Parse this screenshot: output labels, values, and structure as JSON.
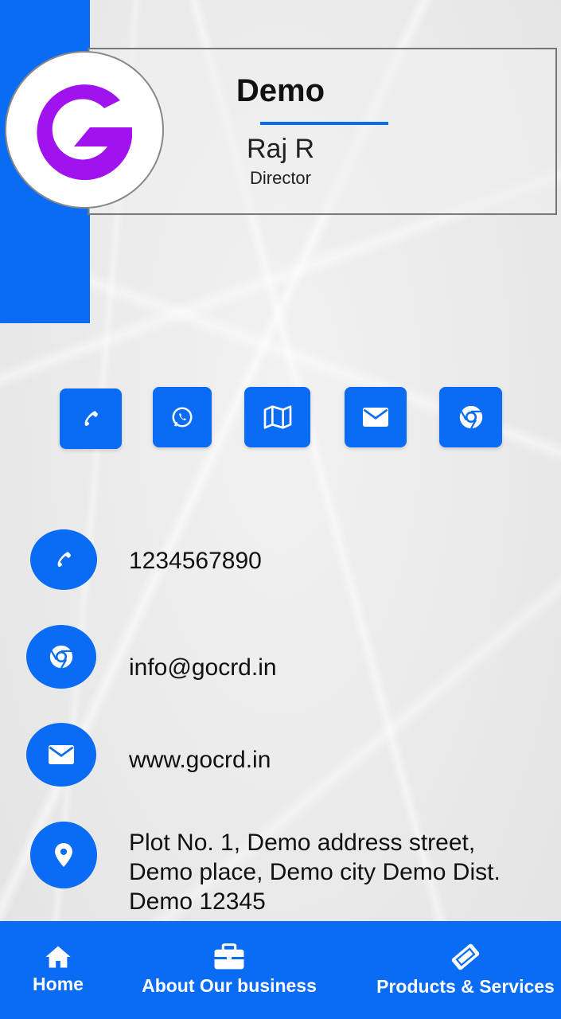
{
  "profile": {
    "company": "Demo",
    "name": "Raj R",
    "designation": "Director"
  },
  "quick_actions": [
    {
      "icon": "phone-icon"
    },
    {
      "icon": "whatsapp-icon"
    },
    {
      "icon": "map-icon"
    },
    {
      "icon": "mail-icon"
    },
    {
      "icon": "chrome-icon"
    }
  ],
  "contact": {
    "phone": "1234567890",
    "email": "info@gocrd.in",
    "website": "www.gocrd.in",
    "address": "Plot No. 1, Demo address street, Demo place, Demo city Demo Dist. Demo 12345"
  },
  "nav": {
    "home": "Home",
    "about": "About Our business",
    "products": "Products & Services"
  },
  "colors": {
    "accent": "#0a6cf5",
    "logo": "#a012ee"
  }
}
